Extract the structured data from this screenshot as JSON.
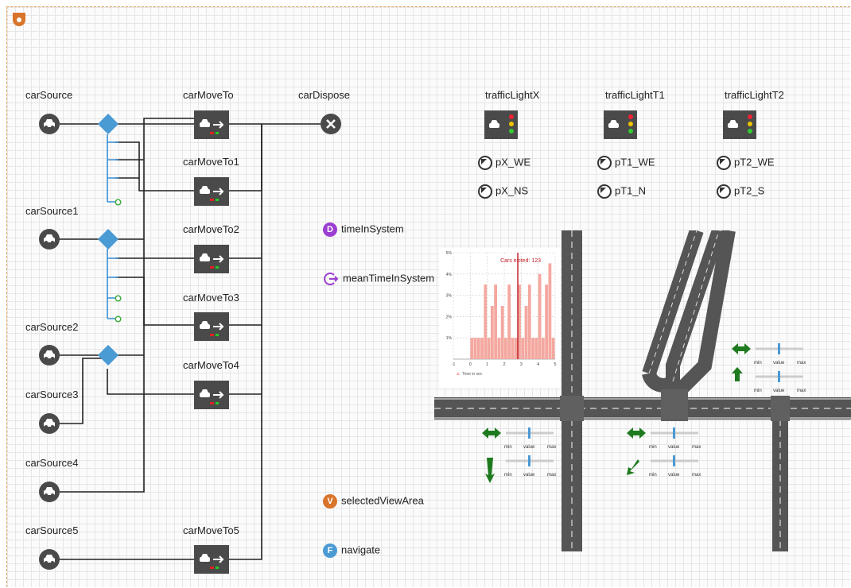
{
  "flowchart": {
    "sources": [
      "carSource",
      "carSource1",
      "carSource2",
      "carSource3",
      "carSource4",
      "carSource5"
    ],
    "moves": [
      "carMoveTo",
      "carMoveTo1",
      "carMoveTo2",
      "carMoveTo3",
      "carMoveTo4",
      "carMoveTo5"
    ],
    "dispose": "carDispose"
  },
  "traffic_lights": [
    {
      "name": "trafficLightX",
      "params": [
        "pX_WE",
        "pX_NS"
      ]
    },
    {
      "name": "trafficLightT1",
      "params": [
        "pT1_WE",
        "pT1_N"
      ]
    },
    {
      "name": "trafficLightT2",
      "params": [
        "pT2_WE",
        "pT2_S"
      ]
    }
  ],
  "elements": {
    "dataset": {
      "label": "timeInSystem",
      "icon_letter": "D"
    },
    "function_mean": {
      "label": "meanTimeInSystem"
    },
    "view_area": {
      "label": "selectedViewArea",
      "icon_letter": "V"
    },
    "navigate": {
      "label": "navigate",
      "icon_letter": "F"
    }
  },
  "slider_labels": {
    "min": "min",
    "value": "value",
    "max": "max"
  },
  "colors": {
    "accent": "#4a9ad4",
    "arrow": "#1e7a1e",
    "road": "#555555",
    "bar": "#f4a8a0",
    "marker": "#c0202a",
    "engine": "#4a4a4a"
  },
  "chart_data": {
    "type": "bar",
    "annotation": "Cars exited: 123",
    "legend": "Time in sec",
    "xlim": [
      -1,
      5
    ],
    "ylim": [
      0,
      5
    ],
    "x_ticks": [
      "-1",
      "0",
      "1",
      "2",
      "3",
      "4",
      "5"
    ],
    "y_ticks": [
      "1%",
      "2%",
      "3%",
      "4%",
      "5%"
    ],
    "marker_x": 2.8,
    "x": [
      0.0,
      0.2,
      0.4,
      0.6,
      0.8,
      1.0,
      1.2,
      1.4,
      1.6,
      1.8,
      2.0,
      2.2,
      2.4,
      2.6,
      2.8,
      3.0,
      3.2,
      3.4,
      3.6,
      3.8,
      4.0,
      4.2,
      4.4,
      4.6,
      4.8
    ],
    "values": [
      1,
      1,
      1,
      1,
      3.5,
      1,
      2.5,
      3.5,
      1,
      2.5,
      1,
      3.5,
      1,
      1,
      3.5,
      1,
      2.5,
      3.5,
      1,
      1,
      4,
      1,
      3.5,
      4.5,
      1
    ]
  }
}
